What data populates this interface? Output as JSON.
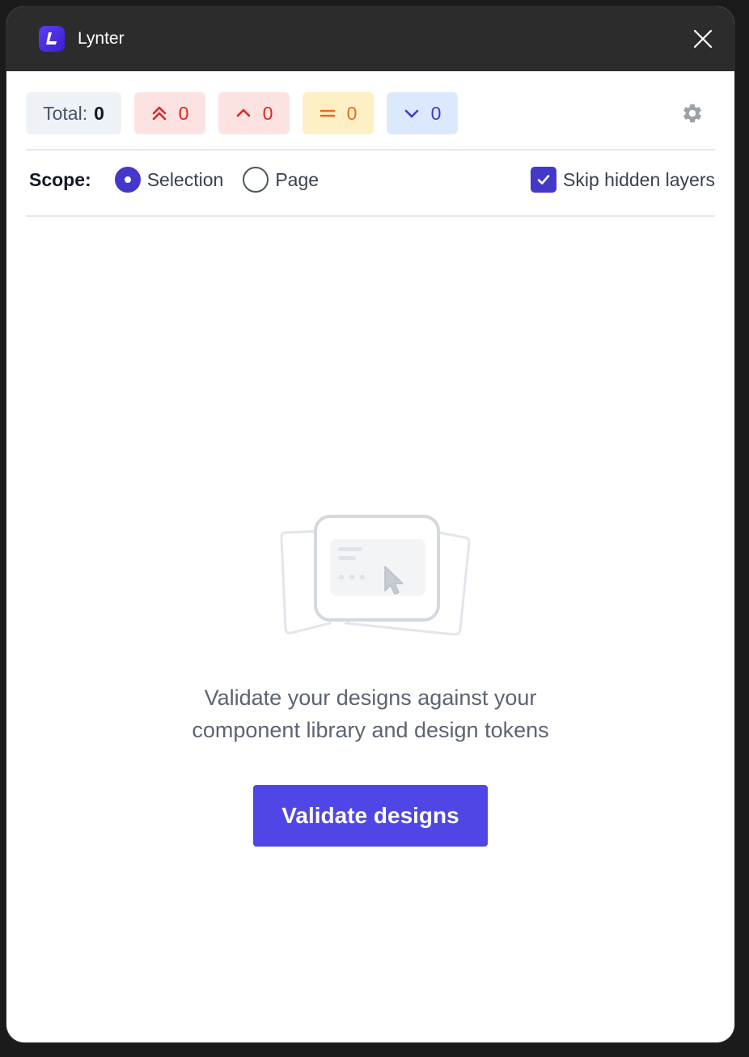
{
  "window": {
    "app_title": "Lynter",
    "icons": {
      "logo": "lynter-logo-icon",
      "close": "close-icon"
    }
  },
  "counts": {
    "total_label": "Total:",
    "total_value": "0",
    "critical_value": "0",
    "high_value": "0",
    "medium_value": "0",
    "low_value": "0",
    "icons": {
      "critical": "double-chevron-up-icon",
      "high": "chevron-up-icon",
      "medium": "equals-icon",
      "low": "chevron-down-icon",
      "settings": "gear-icon"
    },
    "colors": {
      "critical": "#dc2626",
      "high": "#dc2626",
      "medium": "#ea6a1a",
      "low": "#4338ca"
    }
  },
  "scope": {
    "label": "Scope:",
    "options": [
      "Selection",
      "Page"
    ],
    "selected": "Selection",
    "skip_hidden_label": "Skip hidden layers",
    "skip_hidden_checked": true
  },
  "empty_state": {
    "line1": "Validate your designs against your",
    "line2": "component library and design tokens",
    "button_label": "Validate designs"
  },
  "colors": {
    "accent": "#4f46e5",
    "titlebar": "#2c2c2c"
  }
}
